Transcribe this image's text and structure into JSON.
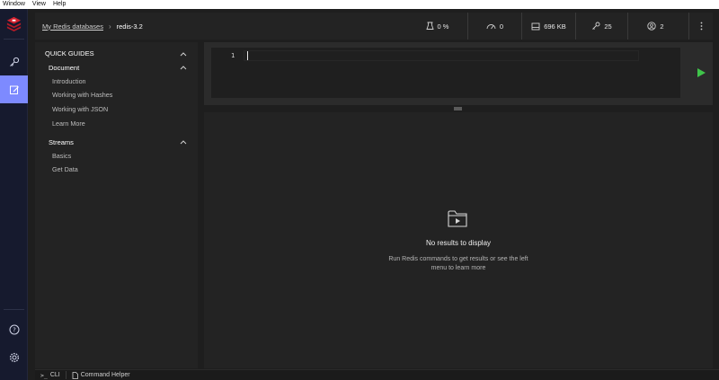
{
  "os_menu": [
    "Window",
    "View",
    "Help"
  ],
  "rail": {
    "items": [
      {
        "name": "browser-icon"
      },
      {
        "name": "workbench-icon",
        "active": true
      },
      {
        "name": "help-icon"
      },
      {
        "name": "settings-icon"
      }
    ],
    "accent": "#7d8aff",
    "logo_color": "#d6222f"
  },
  "header": {
    "breadcrumb_parent": "My Redis databases",
    "breadcrumb_current": "redis-3.2",
    "stats": [
      {
        "icon": "cpu-icon",
        "value": "0 %"
      },
      {
        "icon": "gauge-icon",
        "value": "0"
      },
      {
        "icon": "memory-icon",
        "value": "696 KB"
      },
      {
        "icon": "key-icon",
        "value": "25"
      },
      {
        "icon": "users-icon",
        "value": "2"
      }
    ]
  },
  "guides": {
    "title": "QUICK GUIDES",
    "sections": [
      {
        "title": "Document",
        "links": [
          "Introduction",
          "Working with Hashes",
          "Working with JSON",
          "Learn More"
        ]
      },
      {
        "title": "Streams",
        "links": [
          "Basics",
          "Get Data"
        ]
      }
    ]
  },
  "editor": {
    "line_number": "1",
    "run_color": "#3fc44a"
  },
  "results": {
    "title": "No results to display",
    "subtitle": "Run Redis commands to get results or see the left menu to learn more"
  },
  "bottombar": {
    "cli_label": "CLI",
    "helper_label": "Command Helper"
  }
}
